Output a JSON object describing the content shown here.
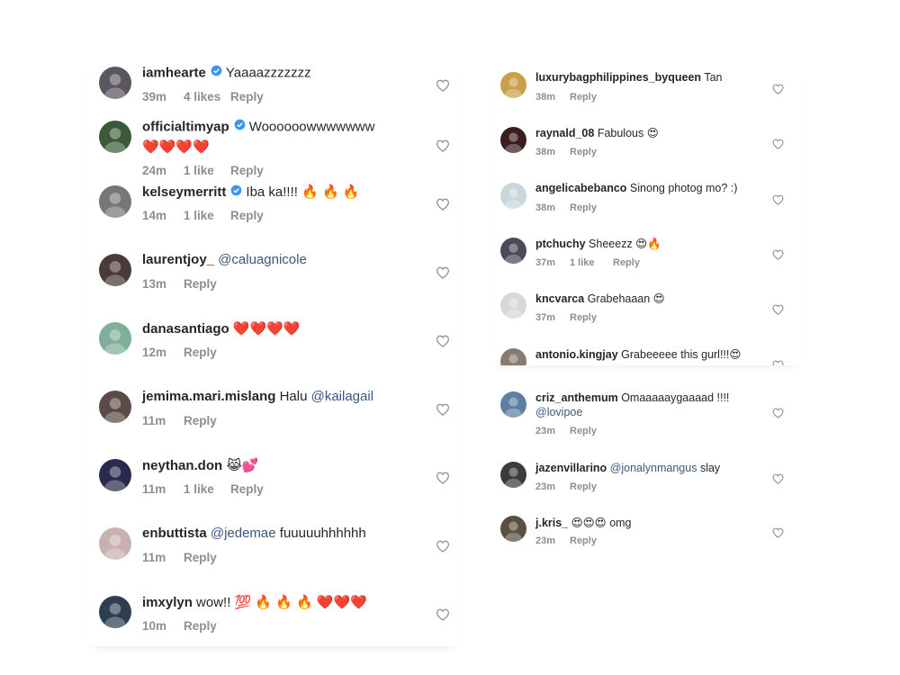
{
  "left_comments": [
    {
      "username": "iamhearte",
      "verified": true,
      "parts": [
        {
          "t": "text",
          "v": "Yaaaazzzzzzz"
        }
      ],
      "time": "39m",
      "likes": "4 likes",
      "reply": "Reply",
      "avatar_color": "#5a5560"
    },
    {
      "username": "officialtimyap",
      "verified": true,
      "parts": [
        {
          "t": "text",
          "v": "Woooooowwwwwww"
        }
      ],
      "line2": "❤️❤️❤️❤️",
      "time": "24m",
      "likes": "1 like",
      "reply": "Reply",
      "avatar_color": "#3c5a3a"
    },
    {
      "username": "kelseymerritt",
      "verified": true,
      "parts": [
        {
          "t": "text",
          "v": "Iba ka!!!! 🔥 🔥 🔥"
        }
      ],
      "time": "14m",
      "likes": "1 like",
      "reply": "Reply",
      "avatar_color": "#777777"
    },
    {
      "username": "laurentjoy_",
      "verified": false,
      "parts": [
        {
          "t": "mention",
          "v": "@caluagnicole"
        }
      ],
      "time": "13m",
      "likes": "",
      "reply": "Reply",
      "avatar_color": "#4a3a38"
    },
    {
      "username": "danasantiago",
      "verified": false,
      "parts": [
        {
          "t": "text",
          "v": "❤️❤️❤️❤️"
        }
      ],
      "time": "12m",
      "likes": "",
      "reply": "Reply",
      "avatar_color": "#7fae9a"
    },
    {
      "username": "jemima.mari.mislang",
      "verified": false,
      "parts": [
        {
          "t": "text",
          "v": "Halu "
        },
        {
          "t": "mention",
          "v": "@kailagail"
        }
      ],
      "time": "11m",
      "likes": "",
      "reply": "Reply",
      "avatar_color": "#5b4b46"
    },
    {
      "username": "neythan.don",
      "verified": false,
      "parts": [
        {
          "t": "text",
          "v": "😹💕"
        }
      ],
      "time": "11m",
      "likes": "1 like",
      "reply": "Reply",
      "avatar_color": "#2a2a4e"
    },
    {
      "username": "enbuttista",
      "verified": false,
      "parts": [
        {
          "t": "mention",
          "v": "@jedemae"
        },
        {
          "t": "text",
          "v": " fuuuuuhhhhhh"
        }
      ],
      "time": "11m",
      "likes": "",
      "reply": "Reply",
      "avatar_color": "#c9b1b0"
    },
    {
      "username": "imxylyn",
      "verified": false,
      "parts": [
        {
          "t": "text",
          "v": "wow!! 💯 🔥 🔥 🔥 ❤️❤️❤️"
        }
      ],
      "time": "10m",
      "likes": "",
      "reply": "Reply",
      "avatar_color": "#2f3f52"
    }
  ],
  "right_comments_a": [
    {
      "username": "luxurybagphilippines_byqueen",
      "parts": [
        {
          "t": "text",
          "v": "Tan"
        }
      ],
      "time": "38m",
      "likes": "",
      "reply": "Reply",
      "avatar_color": "#c8a04a"
    },
    {
      "username": "raynald_08",
      "parts": [
        {
          "t": "text",
          "v": "Fabulous 😍"
        }
      ],
      "time": "38m",
      "likes": "",
      "reply": "Reply",
      "avatar_color": "#3a1e1e"
    },
    {
      "username": "angelicabebanco",
      "parts": [
        {
          "t": "text",
          "v": "Sinong photog mo? :)"
        }
      ],
      "time": "38m",
      "likes": "",
      "reply": "Reply",
      "avatar_color": "#c9d7dc"
    },
    {
      "username": "ptchuchy",
      "parts": [
        {
          "t": "text",
          "v": "Sheeezz 😍🔥"
        }
      ],
      "time": "37m",
      "likes": "1 like",
      "reply": "Reply",
      "avatar_color": "#4a4a5a"
    },
    {
      "username": "kncvarca",
      "parts": [
        {
          "t": "text",
          "v": "Grabehaaan 😍"
        }
      ],
      "time": "37m",
      "likes": "",
      "reply": "Reply",
      "avatar_color": "#d8d8d8"
    },
    {
      "username": "antonio.kingjay",
      "parts": [
        {
          "t": "text",
          "v": "Grabeeeee this gurl!!!😍"
        }
      ],
      "time": "",
      "likes": "",
      "reply": "",
      "avatar_color": "#8a7a70"
    }
  ],
  "right_comments_b": [
    {
      "username": "criz_anthemum",
      "parts": [
        {
          "t": "text",
          "v": "Omaaaaaygaaaad !!!!"
        }
      ],
      "line2_mention": "@lovipoe",
      "time": "23m",
      "likes": "",
      "reply": "Reply",
      "avatar_color": "#5d7fa0"
    },
    {
      "username": "jazenvillarino",
      "parts": [
        {
          "t": "mention",
          "v": "@jonalynmangus"
        },
        {
          "t": "text",
          "v": " slay"
        }
      ],
      "time": "23m",
      "likes": "",
      "reply": "Reply",
      "avatar_color": "#3b3b3b"
    },
    {
      "username": "j.kris_",
      "parts": [
        {
          "t": "text",
          "v": "😍😍😍 omg"
        }
      ],
      "time": "23m",
      "likes": "",
      "reply": "Reply",
      "avatar_color": "#5a5040"
    }
  ],
  "icons": {
    "heart": "heart-outline-icon",
    "verified": "verified-badge-icon"
  },
  "colors": {
    "mention": "#38587f",
    "meta": "#8e8e8e",
    "verified": "#3897f0",
    "text": "#262626"
  }
}
